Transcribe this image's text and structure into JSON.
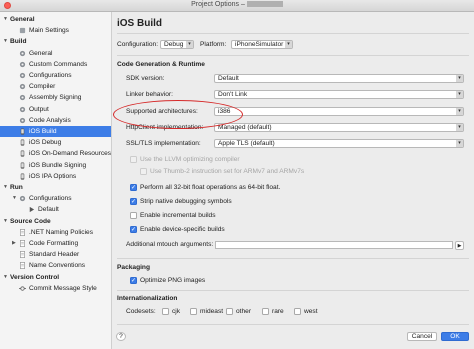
{
  "window": {
    "title": "Project Options –"
  },
  "sidebar": {
    "items": [
      {
        "label": "General",
        "kind": "group",
        "indent": 0,
        "expanded": true
      },
      {
        "label": "Main Settings",
        "kind": "item",
        "indent": 1,
        "icon": "settings-icon"
      },
      {
        "label": "Build",
        "kind": "group",
        "indent": 0,
        "expanded": true
      },
      {
        "label": "General",
        "kind": "item",
        "indent": 1,
        "icon": "gear-icon"
      },
      {
        "label": "Custom Commands",
        "kind": "item",
        "indent": 1,
        "icon": "gear-icon"
      },
      {
        "label": "Configurations",
        "kind": "item",
        "indent": 1,
        "icon": "gear-icon"
      },
      {
        "label": "Compiler",
        "kind": "item",
        "indent": 1,
        "icon": "gear-icon"
      },
      {
        "label": "Assembly Signing",
        "kind": "item",
        "indent": 1,
        "icon": "gear-icon"
      },
      {
        "label": "Output",
        "kind": "item",
        "indent": 1,
        "icon": "gear-icon"
      },
      {
        "label": "Code Analysis",
        "kind": "item",
        "indent": 1,
        "icon": "gear-icon"
      },
      {
        "label": "iOS Build",
        "kind": "item",
        "indent": 1,
        "icon": "ios-icon",
        "selected": true
      },
      {
        "label": "iOS Debug",
        "kind": "item",
        "indent": 1,
        "icon": "ios-icon"
      },
      {
        "label": "iOS On-Demand Resources",
        "kind": "item",
        "indent": 1,
        "icon": "ios-icon"
      },
      {
        "label": "iOS Bundle Signing",
        "kind": "item",
        "indent": 1,
        "icon": "ios-icon"
      },
      {
        "label": "iOS IPA Options",
        "kind": "item",
        "indent": 1,
        "icon": "ios-icon"
      },
      {
        "label": "Run",
        "kind": "group",
        "indent": 0,
        "expanded": true
      },
      {
        "label": "Configurations",
        "kind": "subgroup",
        "indent": 1,
        "icon": "gear-icon",
        "expanded": true
      },
      {
        "label": "Default",
        "kind": "item",
        "indent": 2,
        "icon": "play-icon"
      },
      {
        "label": "Source Code",
        "kind": "group",
        "indent": 0,
        "expanded": true
      },
      {
        "label": ".NET Naming Policies",
        "kind": "item",
        "indent": 1,
        "icon": "document-icon"
      },
      {
        "label": "Code Formatting",
        "kind": "subgroup",
        "indent": 1,
        "icon": "document-icon",
        "expanded": false
      },
      {
        "label": "Standard Header",
        "kind": "item",
        "indent": 1,
        "icon": "document-icon"
      },
      {
        "label": "Name Conventions",
        "kind": "item",
        "indent": 1,
        "icon": "document-icon"
      },
      {
        "label": "Version Control",
        "kind": "group",
        "indent": 0,
        "expanded": true
      },
      {
        "label": "Commit Message Style",
        "kind": "item",
        "indent": 1,
        "icon": "commit-icon"
      }
    ]
  },
  "main": {
    "title": "iOS Build",
    "configuration_label": "Configuration:",
    "configuration_value": "Debug",
    "platform_label": "Platform:",
    "platform_value": "iPhoneSimulator",
    "section_codegen": "Code Generation & Runtime",
    "sdk_label": "SDK version:",
    "sdk_value": "Default",
    "linker_label": "Linker behavior:",
    "linker_value": "Don't Link",
    "arch_label": "Supported architectures:",
    "arch_value": "i386",
    "http_label": "HttpClient implementation:",
    "http_value": "Managed (default)",
    "ssl_label": "SSL/TLS implementation:",
    "ssl_value": "Apple TLS (default)",
    "llvm_label": "Use the LLVM optimizing compiler",
    "thumb_label": "Use Thumb-2 instruction set for ARMv7 and ARMv7s",
    "float_label": "Perform all 32-bit float operations as 64-bit float.",
    "strip_label": "Strip native debugging symbols",
    "incremental_label": "Enable incremental builds",
    "device_builds_label": "Enable device-specific builds",
    "mtouch_label": "Additional mtouch arguments:",
    "mtouch_value": "",
    "section_packaging": "Packaging",
    "png_label": "Optimize PNG images",
    "section_i18n": "Internationalization",
    "codesets_label": "Codesets:",
    "codesets": [
      "cjk",
      "mideast",
      "other",
      "rare",
      "west"
    ],
    "help_label": "?",
    "cancel_label": "Cancel",
    "ok_label": "OK",
    "checkboxes": {
      "llvm": false,
      "thumb": false,
      "float": true,
      "strip": true,
      "incremental": false,
      "device_builds": true,
      "png": true
    }
  },
  "colors": {
    "selection": "#3d7de7",
    "highlight": "#d62a2a"
  }
}
